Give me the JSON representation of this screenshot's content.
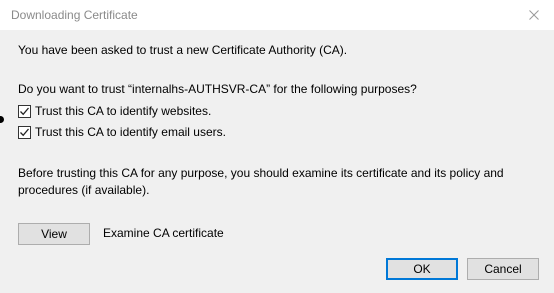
{
  "window": {
    "title": "Downloading Certificate",
    "close_icon": "close-icon"
  },
  "body": {
    "intro": "You have been asked to trust a new Certificate Authority (CA).",
    "question": "Do you want to trust “internalhs-AUTHSVR-CA” for the following purposes?",
    "options": [
      {
        "label": "Trust this CA to identify websites.",
        "checked": true
      },
      {
        "label": "Trust this CA to identify email users.",
        "checked": true
      }
    ],
    "advice": "Before trusting this CA for any purpose, you should examine its certificate and its policy and procedures (if available).",
    "view_button": "View",
    "view_description": "Examine CA certificate"
  },
  "footer": {
    "ok_button": "OK",
    "cancel_button": "Cancel"
  },
  "colors": {
    "background": "#f0f0f0",
    "titlebar": "#ffffff",
    "accent_focus": "#0078d7",
    "button_face": "#e1e1e1"
  }
}
